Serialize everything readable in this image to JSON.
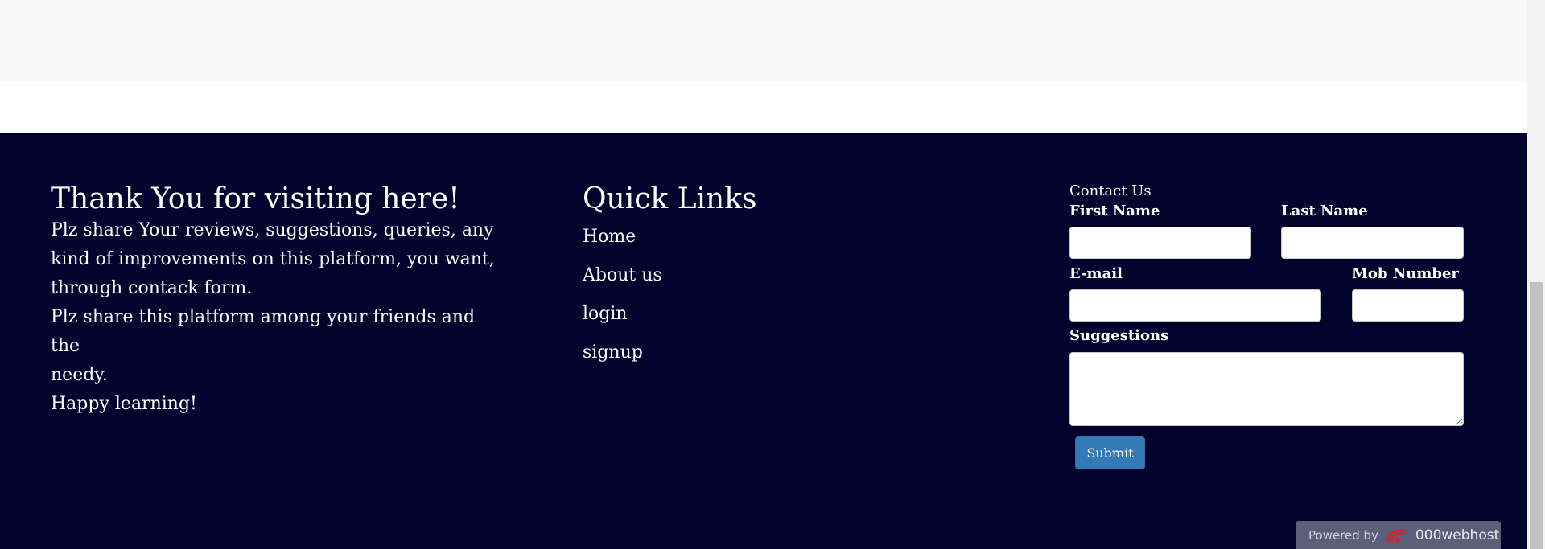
{
  "footer": {
    "thanks": {
      "title": "Thank You for visiting here!",
      "line1": "Plz share Your reviews, suggestions, queries, any",
      "line2": "kind of improvements on this platform, you want,",
      "line3": "through contack form.",
      "line4": "Plz share this platform among your friends and the",
      "line5": "needy.",
      "line6": "Happy learning!"
    },
    "quick_links": {
      "title": "Quick Links",
      "items": [
        {
          "label": "Home"
        },
        {
          "label": "About us"
        },
        {
          "label": "login"
        },
        {
          "label": "signup"
        }
      ]
    },
    "contact": {
      "title": "Contact Us",
      "first_name_label": "First Name",
      "first_name_value": "",
      "last_name_label": "Last Name",
      "last_name_value": "",
      "email_label": "E-mail",
      "email_value": "",
      "mob_label": "Mob Number",
      "mob_value": "",
      "suggestions_label": "Suggestions",
      "suggestions_value": "",
      "submit_label": "Submit"
    }
  },
  "powered_by": {
    "prefix": "Powered by",
    "brand": "000webhost",
    "icon": "000webhost-logo-icon"
  },
  "colors": {
    "footer_bg": "#03022c",
    "submit_bg": "#337ab7",
    "top_band_bg": "#f7f7f7"
  }
}
